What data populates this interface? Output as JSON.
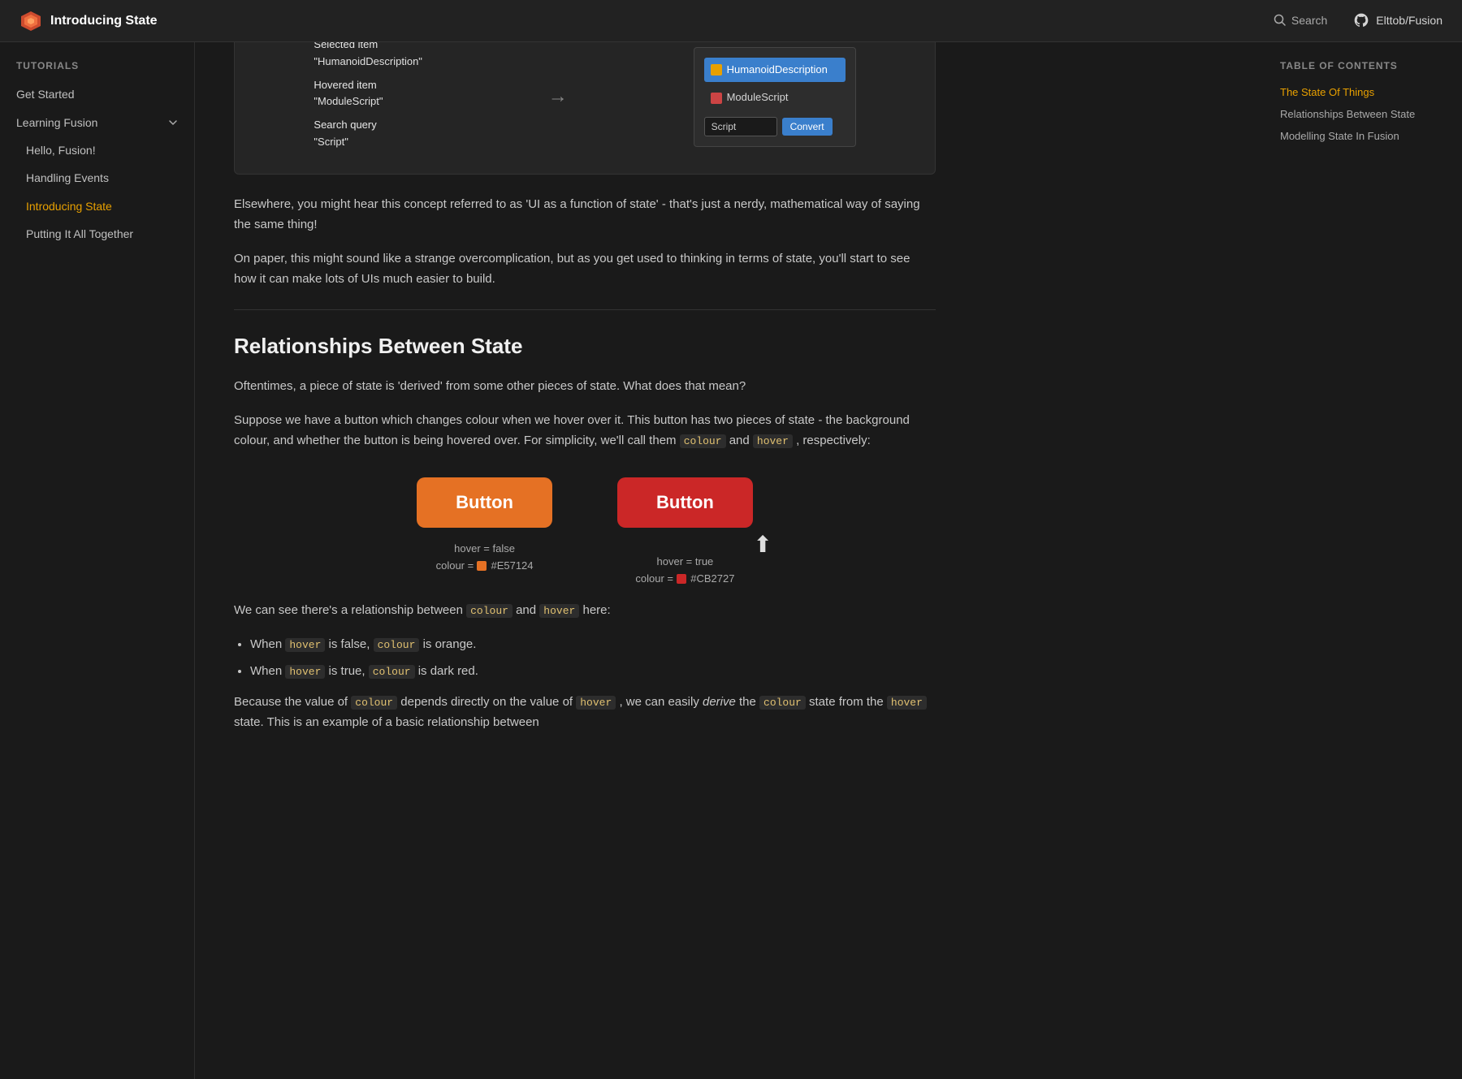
{
  "header": {
    "title": "Introducing State",
    "logo_text": "Introducing State",
    "search_label": "Search",
    "github_label": "Elttob/Fusion"
  },
  "sidebar": {
    "tutorials_label": "Tutorials",
    "get_started_label": "Get Started",
    "learning_fusion_label": "Learning Fusion",
    "sub_items": [
      {
        "label": "Hello, Fusion!",
        "active": false
      },
      {
        "label": "Handling Events",
        "active": false
      },
      {
        "label": "Introducing State",
        "active": true
      },
      {
        "label": "Putting It All Together",
        "active": false
      }
    ]
  },
  "toc": {
    "title": "Table of contents",
    "items": [
      {
        "label": "The State Of Things",
        "active": true
      },
      {
        "label": "Relationships Between State",
        "active": false
      },
      {
        "label": "Modelling State In Fusion",
        "active": false
      }
    ]
  },
  "demo_top": {
    "selected_item_label": "Selected item",
    "selected_item_value": "\"HumanoidDescription\"",
    "hovered_item_label": "Hovered item",
    "hovered_item_value": "\"ModuleScript\"",
    "search_query_label": "Search query",
    "search_query_value": "\"Script\"",
    "list_item1": "HumanoidDescription",
    "list_item2": "ModuleScript",
    "search_placeholder": "Script",
    "convert_btn": "Convert"
  },
  "content": {
    "paragraph1": "Elsewhere, you might hear this concept referred to as 'UI as a function of state' - that's just a nerdy, mathematical way of saying the same thing!",
    "paragraph2": "On paper, this might sound like a strange overcomplication, but as you get used to thinking in terms of state, you'll start to see how it can make lots of UIs much easier to build.",
    "section_heading": "Relationships Between State",
    "para3": "Oftentimes, a piece of state is 'derived' from some other pieces of state. What does that mean?",
    "para4": "Suppose we have a button which changes colour when we hover over it. This button has two pieces of state - the background colour, and whether the button is being hovered over. For simplicity, we'll call them",
    "code_colour": "colour",
    "code_hover": "hover",
    "para4_suffix": "and",
    "para4_end": ", respectively:",
    "btn_left_label": "Button",
    "btn_right_label": "Button",
    "state_left_line1": "hover = false",
    "state_left_line2": "colour =",
    "state_left_color": "#E57124",
    "state_left_hex": "#E57124",
    "state_right_line1": "hover = true",
    "state_right_line2": "colour =",
    "state_right_color": "#CB2727",
    "state_right_hex": "#CB2727",
    "para5_start": "We can see there's a relationship between",
    "code_colour2": "colour",
    "para5_and": "and",
    "code_hover2": "hover",
    "para5_end": "here:",
    "bullet1_pre": "When",
    "bullet1_code": "hover",
    "bullet1_mid": "is false,",
    "bullet1_code2": "colour",
    "bullet1_end": "is orange.",
    "bullet2_pre": "When",
    "bullet2_code": "hover",
    "bullet2_mid": "is true,",
    "bullet2_code2": "colour",
    "bullet2_end": "is dark red.",
    "para6_start": "Because the value of",
    "code_colour3": "colour",
    "para6_mid": "depends directly on the value of",
    "code_hover3": "hover",
    "para6_mid2": ", we can easily",
    "para6_em": "derive",
    "para6_end": "the",
    "code_colour4": "colour",
    "para6_final": "state from the",
    "code_hover4": "hover",
    "para6_last": "state. This is an example of a basic relationship between"
  }
}
